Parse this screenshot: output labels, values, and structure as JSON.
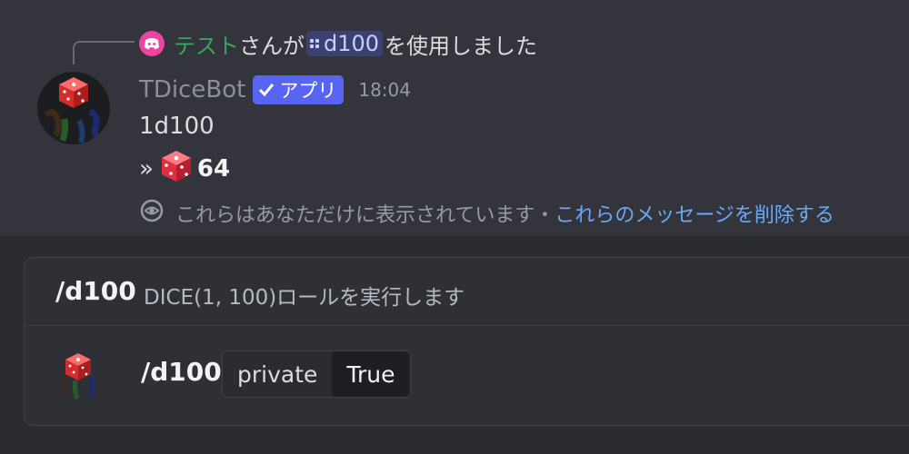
{
  "reply": {
    "user": "テスト",
    "text_before": "さんが",
    "command": "d100",
    "text_after": "を使用しました"
  },
  "message": {
    "author": "TDiceBot",
    "app_tag": "アプリ",
    "timestamp": "18:04",
    "content": "1d100",
    "result_prefix_icon": "double-chevron-right-icon",
    "result_value": "64",
    "ephemeral_text": "これらはあなただけに表示されています・",
    "ephemeral_link": "これらのメッセージを削除する"
  },
  "autocomplete": {
    "command": "/d100",
    "description": "DICE(1, 100)ロールを実行します",
    "option_command": "/d100",
    "param_name": "private",
    "param_value": "True"
  },
  "colors": {
    "accent": "#5865f2",
    "reply_user": "#3ba55c",
    "link": "#6aa9f5",
    "discord_badge": "#eb459f"
  }
}
